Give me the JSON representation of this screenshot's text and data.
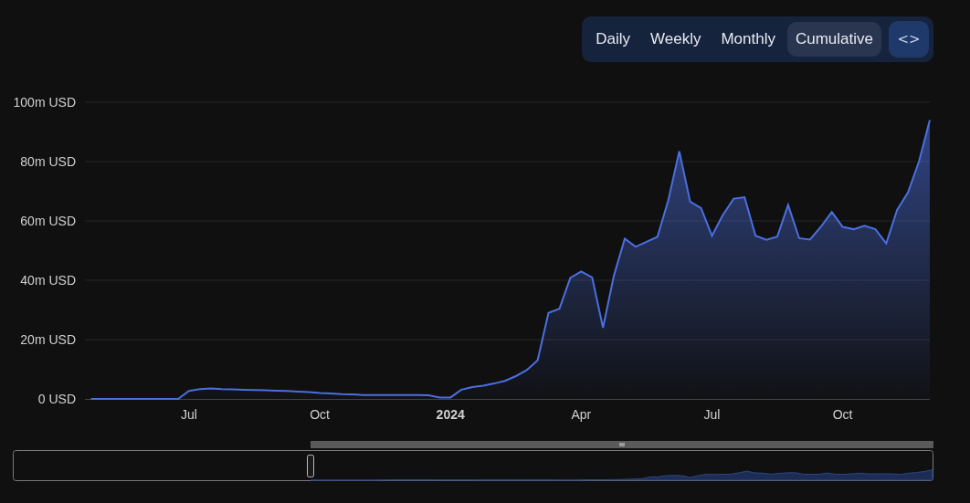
{
  "toolbar": {
    "tabs": [
      {
        "label": "Daily",
        "selected": false
      },
      {
        "label": "Weekly",
        "selected": false
      },
      {
        "label": "Monthly",
        "selected": false
      },
      {
        "label": "Cumulative",
        "selected": true
      }
    ],
    "embed_button": "<>"
  },
  "chart": {
    "chart_data": {
      "type": "area",
      "categories": [
        null,
        null,
        null,
        null,
        null,
        null,
        null,
        null,
        null,
        "Jul",
        null,
        null,
        null,
        null,
        null,
        null,
        null,
        null,
        null,
        null,
        null,
        "Oct",
        null,
        null,
        null,
        null,
        null,
        null,
        null,
        null,
        null,
        null,
        null,
        "2024",
        null,
        null,
        null,
        null,
        null,
        null,
        null,
        null,
        null,
        null,
        null,
        "Apr",
        null,
        null,
        null,
        null,
        null,
        null,
        null,
        null,
        null,
        null,
        null,
        "Jul",
        null,
        null,
        null,
        null,
        null,
        null,
        null,
        null,
        null,
        null,
        null,
        "Oct",
        null,
        null,
        null,
        null,
        null,
        null,
        null,
        null
      ],
      "series": [
        {
          "color": "#4b6fe0",
          "values": [
            0,
            0,
            0,
            0,
            0,
            0,
            0,
            0,
            0,
            2.7,
            3.3,
            3.5,
            3.3,
            3.2,
            3.1,
            3,
            2.9,
            2.8,
            2.7,
            2.5,
            2.3,
            2,
            1.8,
            1.6,
            1.5,
            1.3,
            1.3,
            1.3,
            1.3,
            1.3,
            1.3,
            1.2,
            0.5,
            0.5,
            3.1,
            4,
            4.5,
            5.2,
            6.1,
            7.7,
            9.7,
            13,
            29,
            30.4,
            40.8,
            43,
            41,
            24,
            41.5,
            54,
            51.3,
            53,
            54.6,
            67,
            83.5,
            66.5,
            64.3,
            55,
            62,
            67.5,
            68,
            55,
            53.6,
            54.7,
            65.4,
            54.2,
            53.7,
            58,
            63,
            58,
            57.2,
            58.4,
            57.2,
            52.4,
            63.7,
            69.6,
            80,
            94
          ]
        }
      ],
      "ylim": [
        0,
        100
      ],
      "grid": true,
      "yticks": [
        {
          "value": 0,
          "label": "0 USD"
        },
        {
          "value": 20,
          "label": "20m USD"
        },
        {
          "value": 40,
          "label": "40m USD"
        },
        {
          "value": 60,
          "label": "60m USD"
        },
        {
          "value": 80,
          "label": "80m USD"
        },
        {
          "value": 100,
          "label": "100m USD"
        }
      ]
    }
  }
}
